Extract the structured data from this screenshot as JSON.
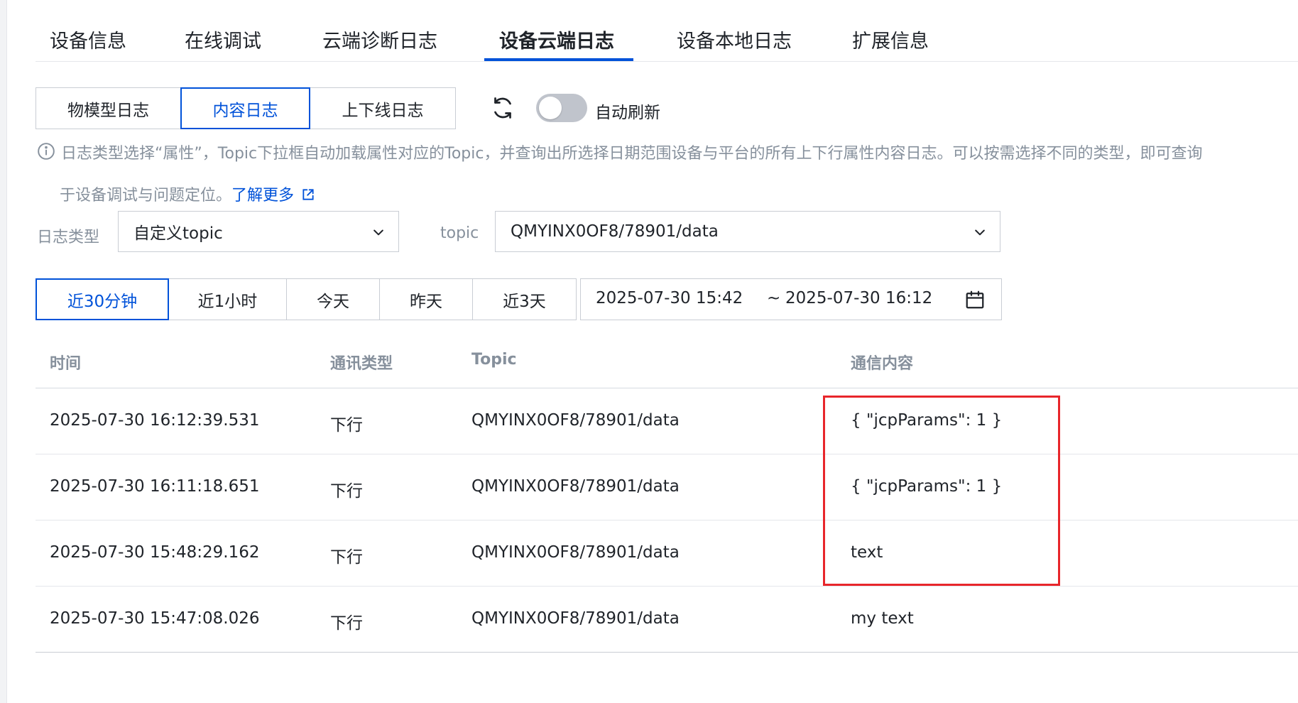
{
  "tabs": [
    {
      "label": "设备信息"
    },
    {
      "label": "在线调试"
    },
    {
      "label": "云端诊断日志"
    },
    {
      "label": "设备云端日志",
      "active": true
    },
    {
      "label": "设备本地日志"
    },
    {
      "label": "扩展信息"
    }
  ],
  "log_types": [
    {
      "label": "物模型日志"
    },
    {
      "label": "内容日志",
      "active": true
    },
    {
      "label": "上下线日志"
    }
  ],
  "auto_refresh": {
    "label": "自动刷新",
    "on": false
  },
  "hint": {
    "line1": "日志类型选择“属性”，Topic下拉框自动加载属性对应的Topic，并查询出所选择日期范围设备与平台的所有上下行属性内容日志。可以按需选择不同的类型，即可查询",
    "line2": "于设备调试与问题定位。",
    "learn_more": "了解更多"
  },
  "filters": {
    "log_type_label": "日志类型",
    "log_type_value": "自定义topic",
    "topic_label": "topic",
    "topic_value": "QMYINX0OF8/78901/data"
  },
  "time_ranges": [
    {
      "label": "近30分钟",
      "active": true
    },
    {
      "label": "近1小时"
    },
    {
      "label": "今天"
    },
    {
      "label": "昨天"
    },
    {
      "label": "近3天"
    }
  ],
  "date_range": {
    "start": "2025-07-30 15:42",
    "separator": "~",
    "end": "2025-07-30 16:12"
  },
  "table": {
    "headers": [
      "时间",
      "通讯类型",
      "Topic",
      "通信内容"
    ],
    "rows": [
      [
        "2025-07-30 16:12:39.531",
        "下行",
        "QMYINX0OF8/78901/data",
        "{ \"jcpParams\": 1 }"
      ],
      [
        "2025-07-30 16:11:18.651",
        "下行",
        "QMYINX0OF8/78901/data",
        "{ \"jcpParams\": 1 }"
      ],
      [
        "2025-07-30 15:48:29.162",
        "下行",
        "QMYINX0OF8/78901/data",
        "text"
      ],
      [
        "2025-07-30 15:47:08.026",
        "下行",
        "QMYINX0OF8/78901/data",
        "my text"
      ]
    ]
  },
  "colors": {
    "primary": "#0052d9",
    "annotation": "#e8262b"
  }
}
